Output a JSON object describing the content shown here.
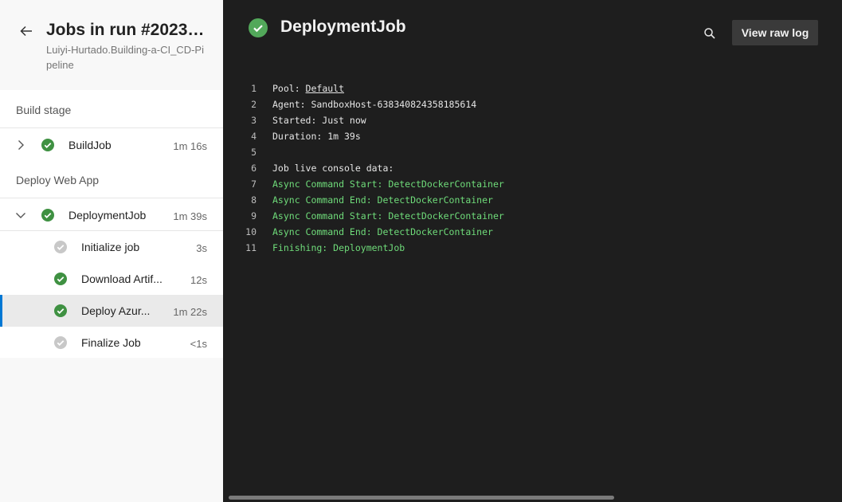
{
  "header": {
    "title": "Jobs in run #20231...",
    "subtitle": "Luiyi-Hurtado.Building-a-CI_CD-Pipeline"
  },
  "stages": [
    {
      "label": "Build stage",
      "jobs": [
        {
          "label": "BuildJob",
          "duration": "1m 16s",
          "status": "succeeded",
          "expanded": false
        }
      ]
    },
    {
      "label": "Deploy Web App",
      "jobs": [
        {
          "label": "DeploymentJob",
          "duration": "1m 39s",
          "status": "succeeded",
          "expanded": true,
          "steps": [
            {
              "label": "Initialize job",
              "duration": "3s",
              "status": "pending"
            },
            {
              "label": "Download Artif...",
              "duration": "12s",
              "status": "succeeded"
            },
            {
              "label": "Deploy Azur...",
              "duration": "1m 22s",
              "status": "succeeded",
              "selected": true
            },
            {
              "label": "Finalize Job",
              "duration": "<1s",
              "status": "pending"
            }
          ]
        }
      ]
    }
  ],
  "main": {
    "job_title": "DeploymentJob",
    "view_raw_label": "View raw log",
    "log_lines": [
      {
        "n": "1",
        "prefix": "Pool: ",
        "link": "Default",
        "color": "default"
      },
      {
        "n": "2",
        "text": "Agent: SandboxHost-638340824358185614",
        "color": "default"
      },
      {
        "n": "3",
        "text": "Started: Just now",
        "color": "default"
      },
      {
        "n": "4",
        "text": "Duration: 1m 39s",
        "color": "default"
      },
      {
        "n": "5",
        "text": "",
        "color": "default"
      },
      {
        "n": "6",
        "text": "Job live console data:",
        "color": "default"
      },
      {
        "n": "7",
        "text": "Async Command Start: DetectDockerContainer",
        "color": "green"
      },
      {
        "n": "8",
        "text": "Async Command End: DetectDockerContainer",
        "color": "green"
      },
      {
        "n": "9",
        "text": "Async Command Start: DetectDockerContainer",
        "color": "green"
      },
      {
        "n": "10",
        "text": "Async Command End: DetectDockerContainer",
        "color": "green"
      },
      {
        "n": "11",
        "text": "Finishing: DeploymentJob",
        "color": "green"
      }
    ]
  },
  "colors": {
    "success": "#3f9142",
    "pending": "#c8c8c8",
    "accent": "#0078d4",
    "log_green": "#6fdc7a"
  },
  "icons": {
    "back": "arrow-left-icon",
    "search": "search-icon",
    "success": "check-circle-icon",
    "pending": "pending-circle-icon"
  }
}
